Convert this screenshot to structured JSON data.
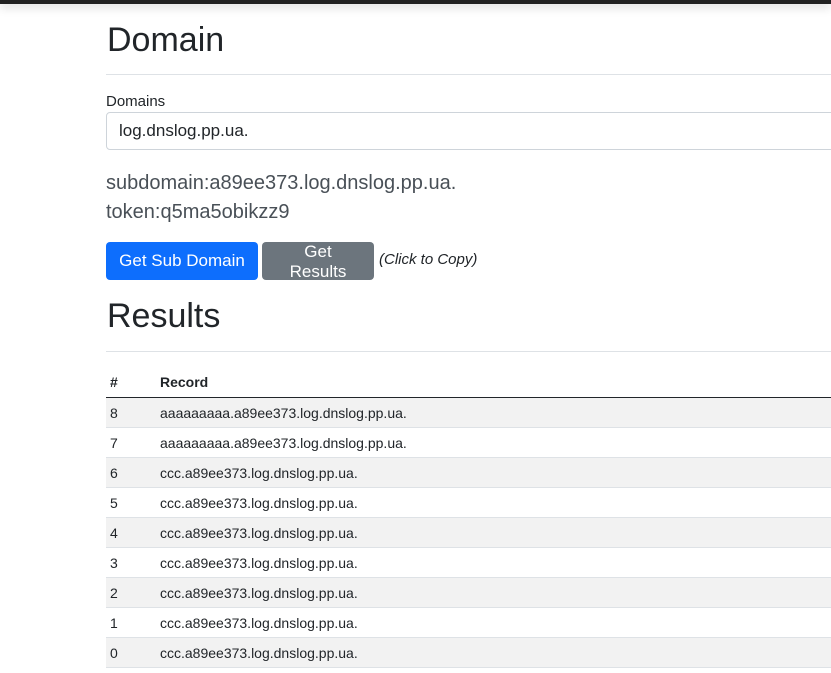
{
  "page": {
    "title": "Domain",
    "domains_label": "Domains",
    "domains_value": "log.dnslog.pp.ua.",
    "subdomain_text": "subdomain:a89ee373.log.dnslog.pp.ua.",
    "token_text": "token:q5ma5obikzz9",
    "get_sub_domain_label": "Get Sub Domain",
    "get_results_label": "Get Results",
    "copy_hint": "(Click to Copy)",
    "results_title": "Results"
  },
  "table": {
    "headers": [
      "#",
      "Record"
    ],
    "rows": [
      {
        "num": "8",
        "record": "aaaaaaaaa.a89ee373.log.dnslog.pp.ua."
      },
      {
        "num": "7",
        "record": "aaaaaaaaa.a89ee373.log.dnslog.pp.ua."
      },
      {
        "num": "6",
        "record": "ccc.a89ee373.log.dnslog.pp.ua."
      },
      {
        "num": "5",
        "record": "ccc.a89ee373.log.dnslog.pp.ua."
      },
      {
        "num": "4",
        "record": "ccc.a89ee373.log.dnslog.pp.ua."
      },
      {
        "num": "3",
        "record": "ccc.a89ee373.log.dnslog.pp.ua."
      },
      {
        "num": "2",
        "record": "ccc.a89ee373.log.dnslog.pp.ua."
      },
      {
        "num": "1",
        "record": "ccc.a89ee373.log.dnslog.pp.ua."
      },
      {
        "num": "0",
        "record": "ccc.a89ee373.log.dnslog.pp.ua."
      }
    ]
  },
  "colors": {
    "primary": "#0d6efd",
    "secondary": "#6c757d",
    "stripe": "#f2f2f2"
  }
}
